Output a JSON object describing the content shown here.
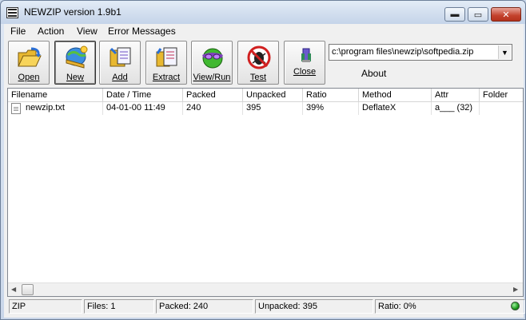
{
  "window": {
    "title": "NEWZIP version 1.9b1",
    "buttons": {
      "minimize": "▬",
      "maximize": "▭",
      "close": "✕"
    }
  },
  "menu": [
    "File",
    "Action",
    "View",
    "Error Messages"
  ],
  "toolbar": [
    {
      "id": "open",
      "label": "Open",
      "icon": "open-folder-icon"
    },
    {
      "id": "new",
      "label": "New",
      "icon": "new-archive-icon"
    },
    {
      "id": "add",
      "label": "Add",
      "icon": "add-files-icon"
    },
    {
      "id": "extract",
      "label": "Extract",
      "icon": "extract-files-icon"
    },
    {
      "id": "view-run",
      "label": "View/Run",
      "icon": "view-run-icon"
    },
    {
      "id": "test",
      "label": "Test",
      "icon": "test-bug-icon"
    },
    {
      "id": "close",
      "label": "Close",
      "icon": "close-archive-icon"
    }
  ],
  "path": {
    "value": "c:\\program files\\newzip\\softpedia.zip"
  },
  "about_label": "About",
  "columns": [
    "Filename",
    "Date / Time",
    "Packed",
    "Unpacked",
    "Ratio",
    "Method",
    "Attr",
    "Folder"
  ],
  "rows": [
    {
      "filename": "newzip.txt",
      "datetime": "04-01-00 11:49",
      "packed": "240",
      "unpacked": "395",
      "ratio": "39%",
      "method": "DeflateX",
      "attr": "a___ (32)",
      "folder": ""
    }
  ],
  "status": {
    "type": "ZIP",
    "files": "Files: 1",
    "packed": "Packed: 240",
    "unpacked": "Unpacked: 395",
    "ratio": "Ratio: 0%"
  },
  "colors": {
    "status_led": "#1c9a1c"
  }
}
